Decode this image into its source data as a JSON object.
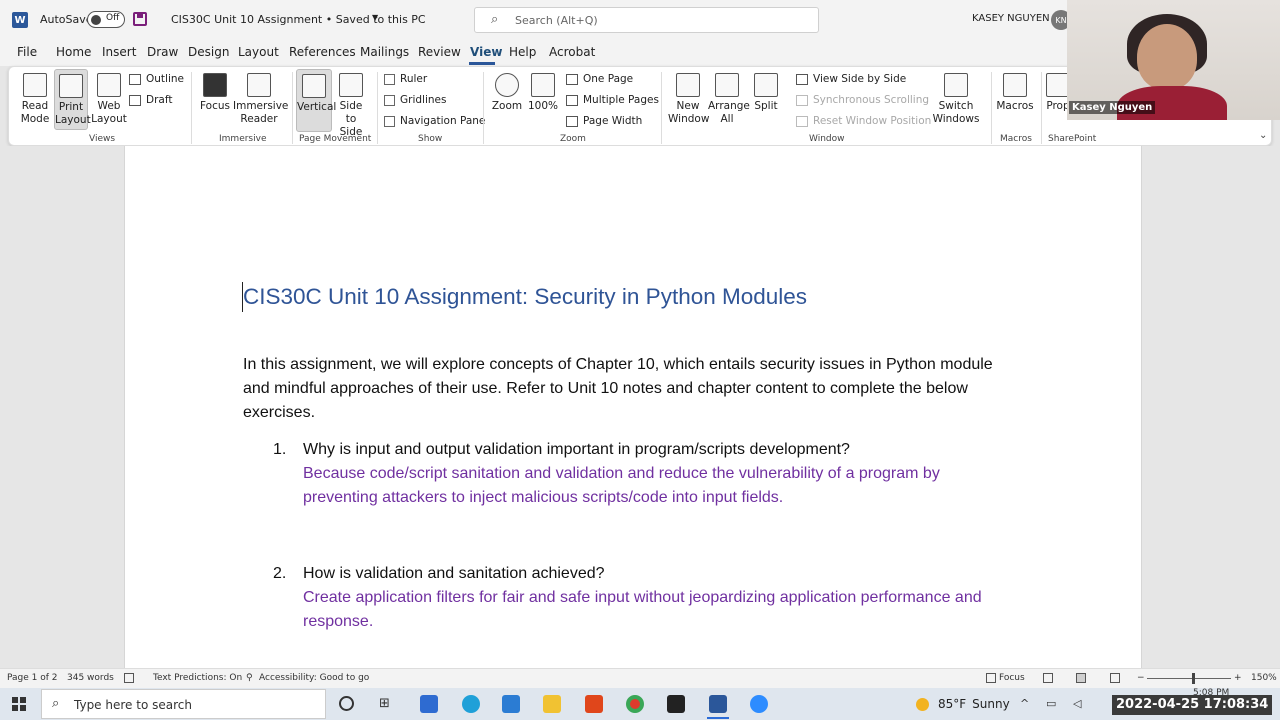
{
  "titlebar": {
    "app_icon": "W",
    "autosave_label": "AutoSave",
    "autosave_state": "Off",
    "doc_title": "CIS30C Unit 10 Assignment • Saved to this PC",
    "search_placeholder": "Search (Alt+Q)",
    "user_name": "KASEY NGUYEN",
    "user_initials": "KN"
  },
  "menu": {
    "items": [
      "File",
      "Home",
      "Insert",
      "Draw",
      "Design",
      "Layout",
      "References",
      "Mailings",
      "Review",
      "View",
      "Help",
      "Acrobat"
    ],
    "active": "View"
  },
  "ribbon": {
    "views": {
      "label": "Views",
      "read_mode": "Read Mode",
      "print_layout": "Print Layout",
      "web_layout": "Web Layout",
      "outline": "Outline",
      "draft": "Draft"
    },
    "immersive": {
      "label": "Immersive",
      "focus": "Focus",
      "immersive_reader": "Immersive Reader"
    },
    "page_movement": {
      "label": "Page Movement",
      "vertical": "Vertical",
      "side_to_side": "Side to Side"
    },
    "show": {
      "label": "Show",
      "ruler": "Ruler",
      "gridlines": "Gridlines",
      "navigation_pane": "Navigation Pane"
    },
    "zoom": {
      "label": "Zoom",
      "zoom": "Zoom",
      "hundred": "100%",
      "one_page": "One Page",
      "multiple_pages": "Multiple Pages",
      "page_width": "Page Width"
    },
    "window": {
      "label": "Window",
      "new_window": "New Window",
      "arrange_all": "Arrange All",
      "split": "Split",
      "view_side_by_side": "View Side by Side",
      "synchronous_scrolling": "Synchronous Scrolling",
      "reset_window_position": "Reset Window Position",
      "switch_windows": "Switch Windows"
    },
    "macros": {
      "label": "Macros",
      "macros": "Macros"
    },
    "sharepoint": {
      "label": "SharePoint",
      "properties": "Prop"
    }
  },
  "webcam": {
    "name": "Kasey Nguyen"
  },
  "document": {
    "heading": "CIS30C Unit 10 Assignment: Security in Python Modules",
    "intro": "In this assignment, we will explore concepts of Chapter 10, which entails security issues in Python module and mindful approaches of their use. Refer to Unit 10 notes and chapter content to complete the below exercises.",
    "q1_num": "1.",
    "q1": "Why is input and output validation important in program/scripts development?",
    "a1": "Because code/script sanitation and validation and reduce the vulnerability of a program by preventing attackers to inject malicious scripts/code into input fields.",
    "q2_num": "2.",
    "q2": "How is validation and sanitation achieved?",
    "a2": "Create application filters for fair and safe input without jeopardizing application performance and response."
  },
  "status": {
    "page": "Page 1 of 2",
    "words": "345 words",
    "text_predictions": "Text Predictions: On",
    "accessibility": "Accessibility: Good to go",
    "focus": "Focus",
    "zoom_level": "150%",
    "zoom_minus": "−",
    "zoom_plus": "+"
  },
  "taskbar": {
    "search_placeholder": "Type here to search",
    "weather_temp": "85°F",
    "weather_desc": "Sunny",
    "clock_time": "5:08 PM",
    "clock_date": "4/25/2022",
    "timestamp": "2022-04-25  17:08:34"
  },
  "colors": {
    "heading": "#2f5496",
    "answer": "#7030a0",
    "word_blue": "#2b579a"
  }
}
